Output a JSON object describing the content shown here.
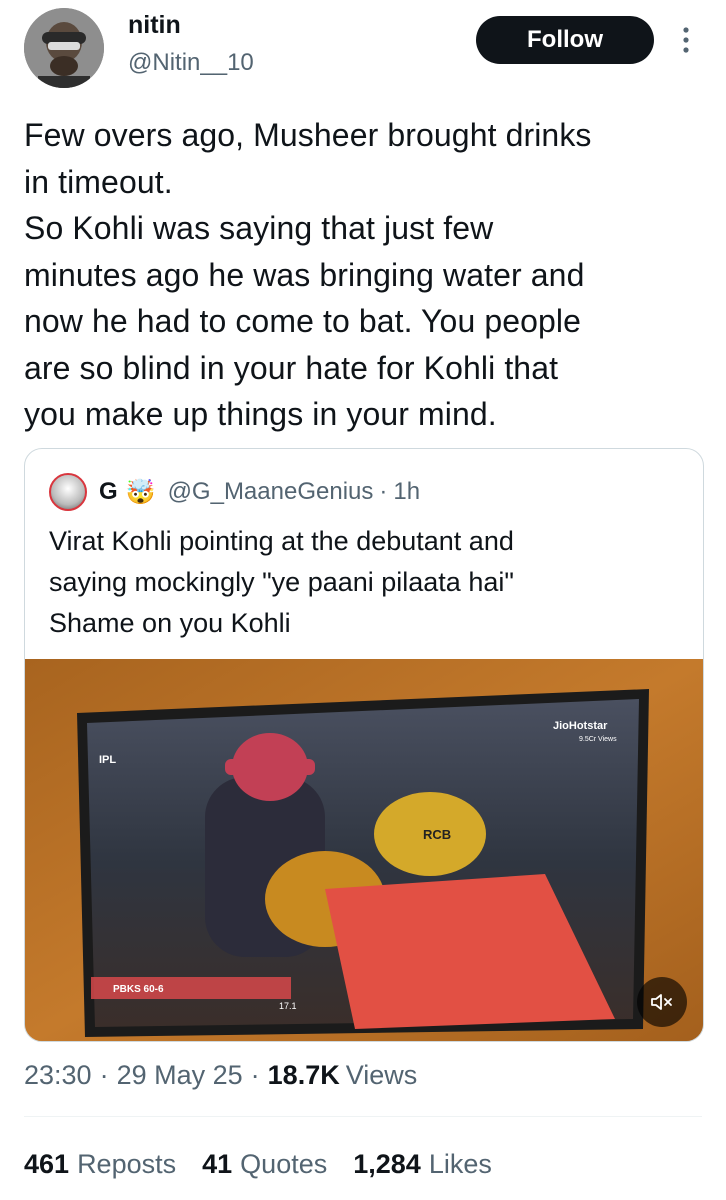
{
  "author": {
    "name": "nitin",
    "handle": "@Nitin__10",
    "follow_label": "Follow"
  },
  "tweet": {
    "text": "Few overs ago, Musheer brought drinks\nin timeout.\nSo Kohli was saying that just few\nminutes ago he was bringing water and\nnow he had to come to bat. You people\nare so blind in your hate for Kohli that\nyou make up things in your mind."
  },
  "quote": {
    "name": "G",
    "emoji": "🤯",
    "handle": "@G_MaaneGenius",
    "separator": "·",
    "time": "1h",
    "text": "Virat Kohli pointing at the debutant and\nsaying mockingly \"ye paani pilaata hai\"\nShame on you Kohli",
    "media": {
      "overlay_brand": "JioHotstar",
      "overlay_views": "9.5Cr Views",
      "overlay_ipl": "IPL",
      "helmet_text": "RCB",
      "score": "PBKS 60-6",
      "over": "17.1",
      "mute_icon": "volume-mute-icon"
    }
  },
  "meta": {
    "time": "23:30",
    "dot1": "·",
    "date": "29 May 25",
    "dot2": "·",
    "views_count": "18.7K",
    "views_label": "Views"
  },
  "stats": {
    "reposts_count": "461",
    "reposts_label": "Reposts",
    "quotes_count": "41",
    "quotes_label": "Quotes",
    "likes_count": "1,284",
    "likes_label": "Likes"
  },
  "colors": {
    "text_primary": "#0f1419",
    "text_secondary": "#536471",
    "border": "#cfd9de",
    "follow_bg": "#0f1419"
  }
}
